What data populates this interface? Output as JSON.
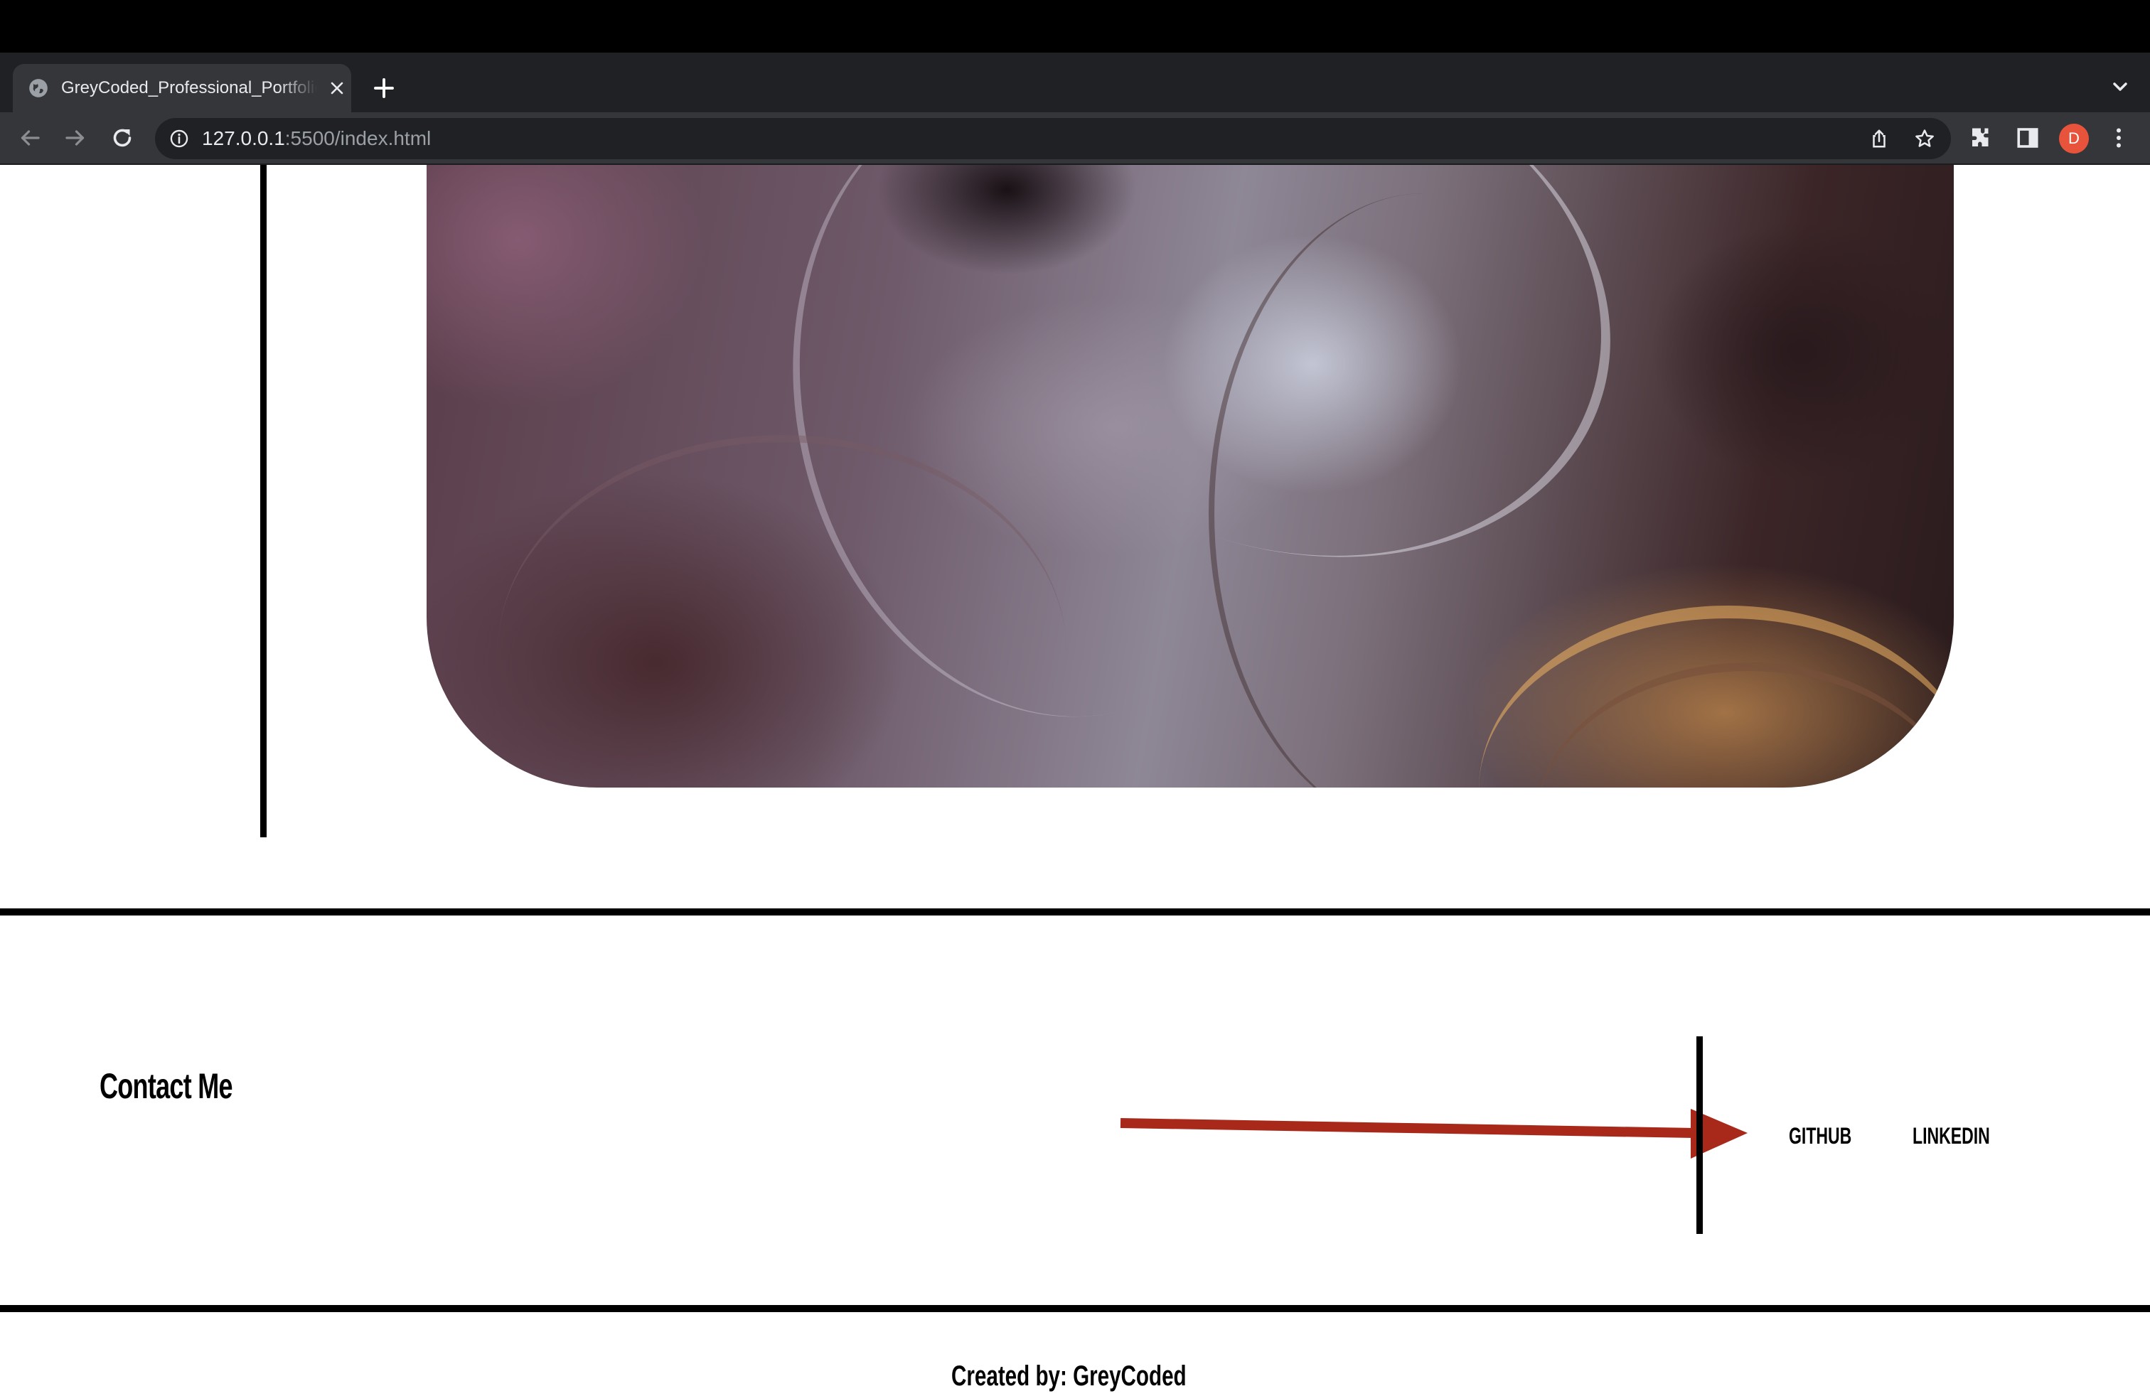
{
  "browser": {
    "tab_title": "GreyCoded_Professional_Portfolio",
    "url_host": "127.0.0.1",
    "url_rest": ":5500/index.html",
    "profile_initial": "D",
    "icons": [
      "globe-icon",
      "close-icon",
      "plus-icon",
      "chevron-down-icon",
      "back-icon",
      "forward-icon",
      "reload-icon",
      "info-icon",
      "share-icon",
      "star-icon",
      "extensions-icon",
      "side-panel-icon",
      "menu-icon"
    ]
  },
  "contact": {
    "title": "Contact Me",
    "links": [
      {
        "label": "GITHUB"
      },
      {
        "label": "LINKEDIN"
      }
    ]
  },
  "footer": {
    "credit": "Created by: GreyCoded"
  },
  "colors": {
    "arrow": "#a8281a",
    "avatar": "#e8543b",
    "chrome_dark": "#202124",
    "chrome_toolbar": "#35363a"
  }
}
